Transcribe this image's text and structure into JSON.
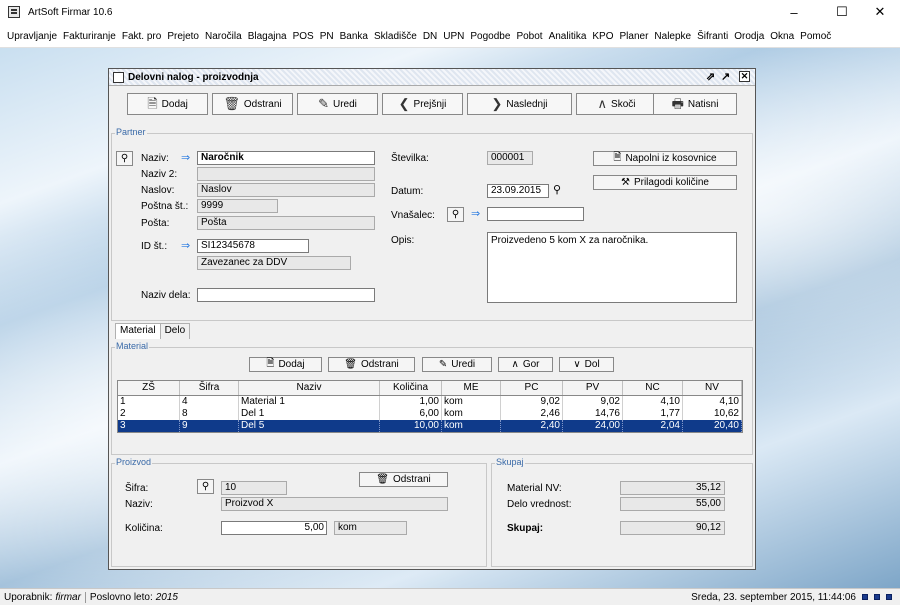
{
  "app": {
    "title": "ArtSoft Firmar 10.6"
  },
  "menu": [
    "Upravljanje",
    "Fakturiranje",
    "Fakt. pro",
    "Prejeto",
    "Naročila",
    "Blagajna",
    "POS",
    "PN",
    "Banka",
    "Skladišče",
    "DN",
    "UPN",
    "Pogodbe",
    "Pobot",
    "Analitika",
    "KPO",
    "Planer",
    "Nalepke",
    "Šifranti",
    "Orodja",
    "Okna",
    "Pomoč"
  ],
  "window": {
    "title": "Delovni nalog - proizvodnja"
  },
  "toolbar": {
    "add": "Dodaj",
    "delete": "Odstrani",
    "edit": "Uredi",
    "prev": "Prejšnji",
    "next": "Naslednji",
    "jump": "Skoči",
    "print": "Natisni"
  },
  "partner": {
    "group_label": "Partner",
    "naziv_label": "Naziv:",
    "naziv": "Naročnik",
    "naziv2_label": "Naziv 2:",
    "naziv2": "",
    "naslov_label": "Naslov:",
    "naslov": "Naslov",
    "posta_st_label": "Poštna št.:",
    "posta_st": "9999",
    "posta_label": "Pošta:",
    "posta": "Pošta",
    "id_label": "ID št.:",
    "id": "SI12345678",
    "ddv": "Zavezanec za DDV",
    "delo_label": "Naziv dela:",
    "delo": ""
  },
  "doc": {
    "stevilka_label": "Številka:",
    "stevilka": "000001",
    "datum_label": "Datum:",
    "datum": "23.09.2015",
    "vnasalec_label": "Vnašalec:",
    "vnasalec": "",
    "opis_label": "Opis:",
    "opis": "Proizvedeno 5 kom X za naročnika.",
    "fill_btn": "Napolni iz kosovnice",
    "adjust_btn": "Prilagodi količine"
  },
  "tabs": [
    "Material",
    "Delo"
  ],
  "material": {
    "group_label": "Material",
    "buttons": {
      "add": "Dodaj",
      "delete": "Odstrani",
      "edit": "Uredi",
      "up": "Gor",
      "down": "Dol"
    },
    "columns": [
      "ZŠ",
      "Šifra",
      "Naziv",
      "Količina",
      "ME",
      "PC",
      "PV",
      "NC",
      "NV"
    ],
    "rows": [
      [
        "1",
        "4",
        "Material 1",
        "1,00",
        "kom",
        "9,02",
        "9,02",
        "4,10",
        "4,10"
      ],
      [
        "2",
        "8",
        "Del 1",
        "6,00",
        "kom",
        "2,46",
        "14,76",
        "1,77",
        "10,62"
      ],
      [
        "3",
        "9",
        "Del 5",
        "10,00",
        "kom",
        "2,40",
        "24,00",
        "2,04",
        "20,40"
      ]
    ]
  },
  "proizvod": {
    "group_label": "Proizvod",
    "sifra_label": "Šifra:",
    "sifra": "10",
    "naziv_label": "Naziv:",
    "naziv": "Proizvod X",
    "kolicina_label": "Količina:",
    "kolicina": "5,00",
    "me": "kom",
    "delete_btn": "Odstrani"
  },
  "skupaj": {
    "group_label": "Skupaj",
    "material_label": "Material NV:",
    "material": "35,12",
    "delo_label": "Delo vrednost:",
    "delo": "55,00",
    "total_label": "Skupaj:",
    "total": "90,12"
  },
  "status": {
    "user_label": "Uporabnik:",
    "user": "firmar",
    "year_label": "Poslovno leto:",
    "year": "2015",
    "datetime": "Sreda, 23. september 2015, 11:44:06"
  }
}
